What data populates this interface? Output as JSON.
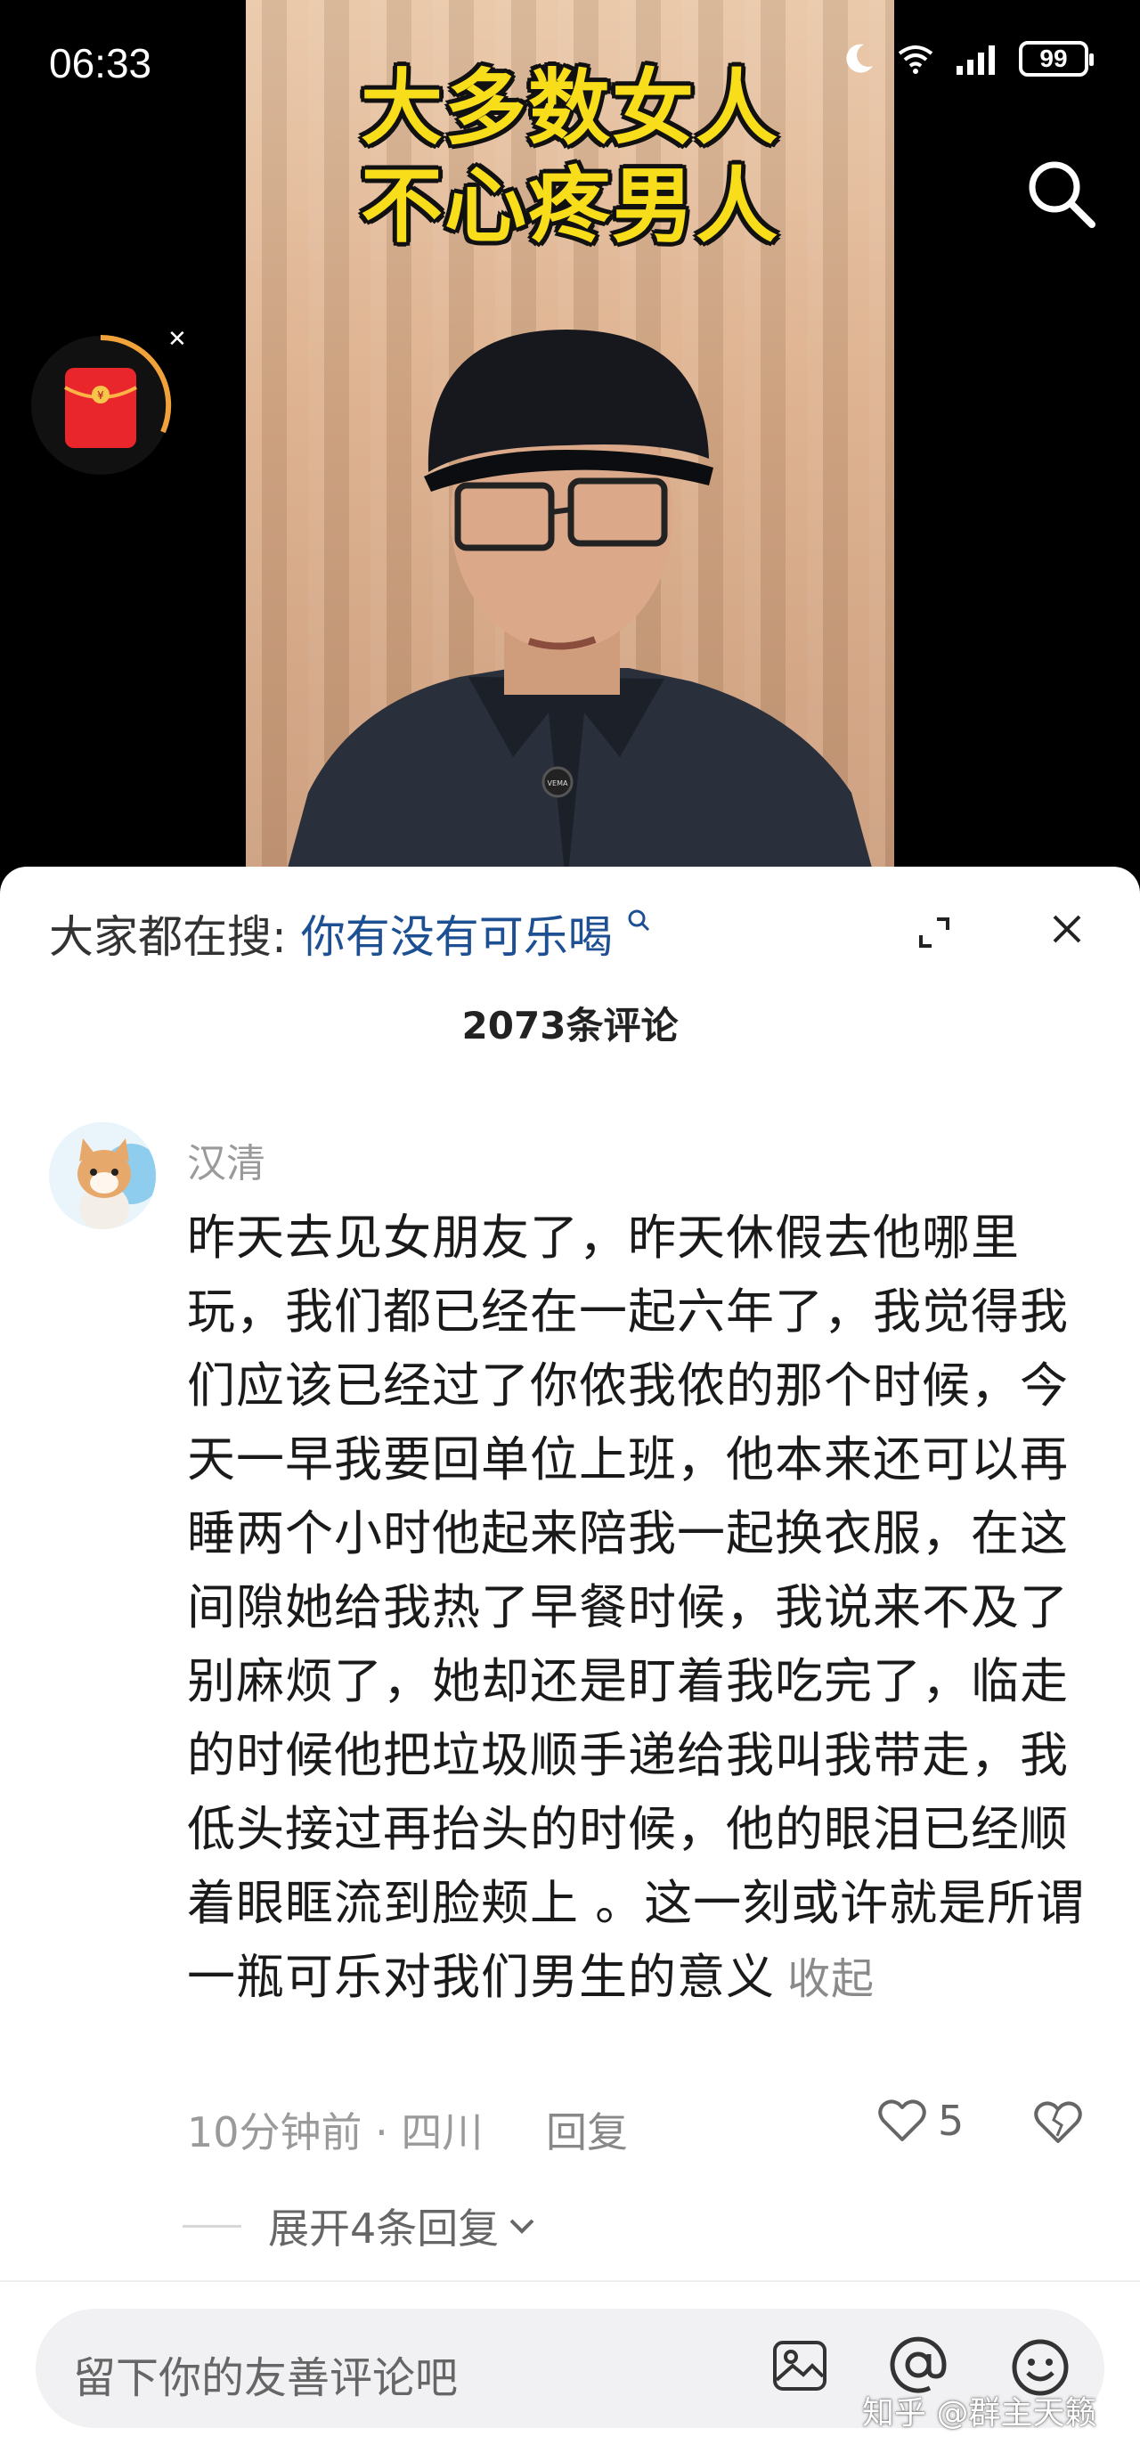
{
  "status_bar": {
    "time": "06:33",
    "battery": "99"
  },
  "video": {
    "headline_line1": "大多数女人",
    "headline_line2": "不心疼男人",
    "shirt_logo": "VEMA"
  },
  "comments_sheet": {
    "search_prefix": "大家都在搜:",
    "search_keyword": "你有没有可乐喝",
    "comment_count": "2073条评论"
  },
  "comment": {
    "username": "汉清",
    "text": "昨天去见女朋友了，昨天休假去他哪里玩，我们都已经在一起六年了，我觉得我们应该已经过了你侬我侬的那个时候，今天一早我要回单位上班，他本来还可以再睡两个小时他起来陪我一起换衣服，在这间隙她给我热了早餐时候，我说来不及了别麻烦了，她却还是盯着我吃完了，临走的时候他把垃圾顺手递给我叫我带走，我低头接过再抬头的时候，他的眼泪已经顺着眼眶流到脸颊上 。这一刻或许就是所谓一瓶可乐对我们男生的意义",
    "collapse_label": "收起",
    "time": "10分钟前",
    "location_sep": "·",
    "location": "四川",
    "reply_label": "回复",
    "like_count": "5",
    "expand_replies": "展开4条回复"
  },
  "input_bar": {
    "placeholder": "留下你的友善评论吧"
  },
  "watermark": "知乎 @群主天籁",
  "colors": {
    "headline_yellow": "#f7dd1a",
    "keyword_blue": "#1d4f93",
    "red_packet": "#e8262b"
  }
}
